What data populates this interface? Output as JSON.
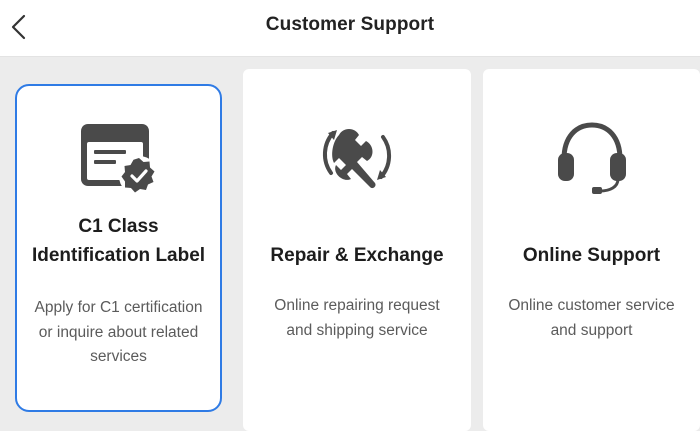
{
  "header": {
    "title": "Customer Support",
    "back_icon": "chevron-left-icon"
  },
  "colors": {
    "accent": "#2f7be5",
    "icon": "#4a4a4a",
    "background": "#ececec",
    "card": "#ffffff"
  },
  "cards": [
    {
      "icon": "certificate-badge-icon",
      "title_lines": [
        "C1 Class",
        "Identification Label"
      ],
      "desc_lines": [
        "Apply for C1 certification",
        "or inquire about related",
        "services"
      ],
      "selected": true
    },
    {
      "icon": "wrench-repair-icon",
      "title_lines": [
        "Repair & Exchange"
      ],
      "desc_lines": [
        "Online repairing request",
        "and shipping service"
      ],
      "selected": false
    },
    {
      "icon": "headset-icon",
      "title_lines": [
        "Online Support"
      ],
      "desc_lines": [
        "Online customer service",
        "and support"
      ],
      "selected": false
    }
  ]
}
